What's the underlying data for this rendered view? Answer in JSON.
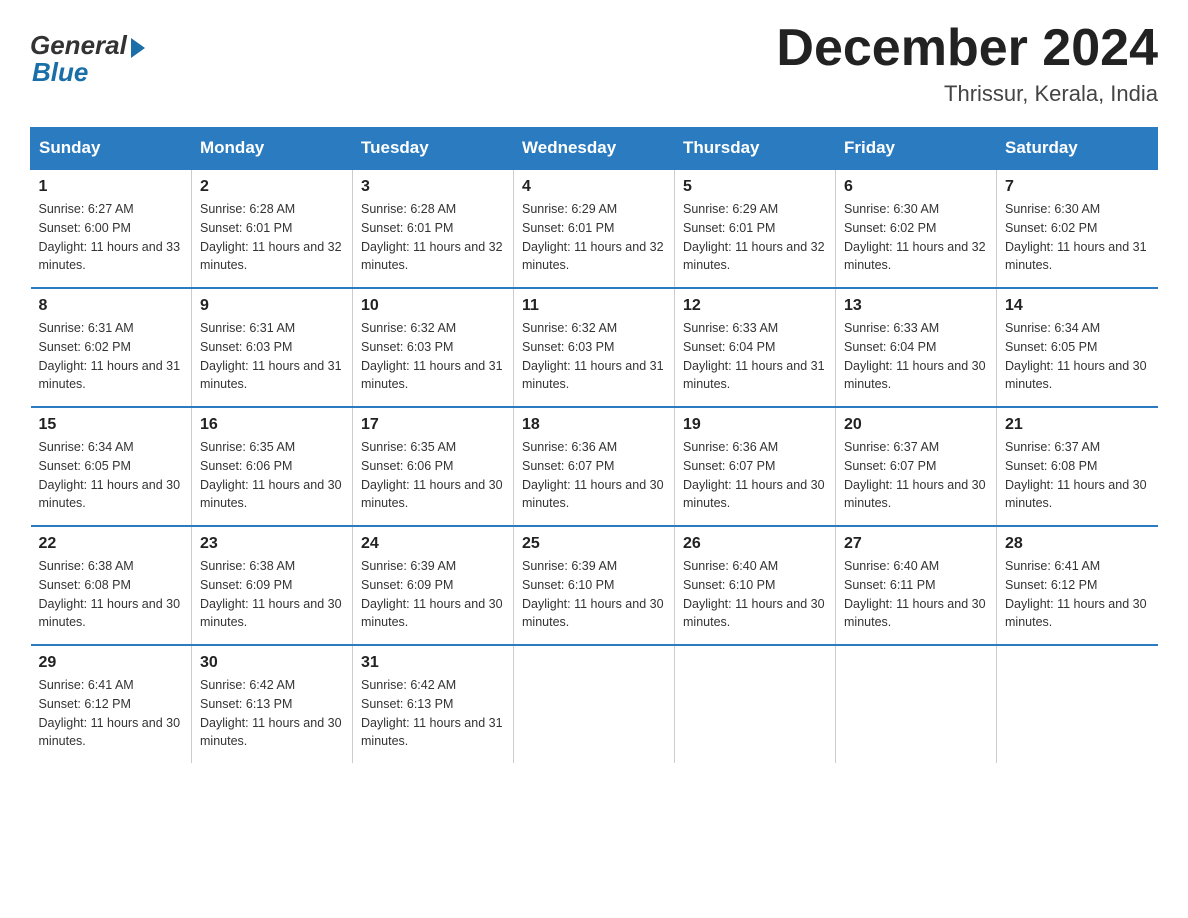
{
  "logo": {
    "general": "General",
    "blue": "Blue"
  },
  "title": "December 2024",
  "subtitle": "Thrissur, Kerala, India",
  "days_of_week": [
    "Sunday",
    "Monday",
    "Tuesday",
    "Wednesday",
    "Thursday",
    "Friday",
    "Saturday"
  ],
  "weeks": [
    [
      {
        "num": "1",
        "sunrise": "6:27 AM",
        "sunset": "6:00 PM",
        "daylight": "11 hours and 33 minutes."
      },
      {
        "num": "2",
        "sunrise": "6:28 AM",
        "sunset": "6:01 PM",
        "daylight": "11 hours and 32 minutes."
      },
      {
        "num": "3",
        "sunrise": "6:28 AM",
        "sunset": "6:01 PM",
        "daylight": "11 hours and 32 minutes."
      },
      {
        "num": "4",
        "sunrise": "6:29 AM",
        "sunset": "6:01 PM",
        "daylight": "11 hours and 32 minutes."
      },
      {
        "num": "5",
        "sunrise": "6:29 AM",
        "sunset": "6:01 PM",
        "daylight": "11 hours and 32 minutes."
      },
      {
        "num": "6",
        "sunrise": "6:30 AM",
        "sunset": "6:02 PM",
        "daylight": "11 hours and 32 minutes."
      },
      {
        "num": "7",
        "sunrise": "6:30 AM",
        "sunset": "6:02 PM",
        "daylight": "11 hours and 31 minutes."
      }
    ],
    [
      {
        "num": "8",
        "sunrise": "6:31 AM",
        "sunset": "6:02 PM",
        "daylight": "11 hours and 31 minutes."
      },
      {
        "num": "9",
        "sunrise": "6:31 AM",
        "sunset": "6:03 PM",
        "daylight": "11 hours and 31 minutes."
      },
      {
        "num": "10",
        "sunrise": "6:32 AM",
        "sunset": "6:03 PM",
        "daylight": "11 hours and 31 minutes."
      },
      {
        "num": "11",
        "sunrise": "6:32 AM",
        "sunset": "6:03 PM",
        "daylight": "11 hours and 31 minutes."
      },
      {
        "num": "12",
        "sunrise": "6:33 AM",
        "sunset": "6:04 PM",
        "daylight": "11 hours and 31 minutes."
      },
      {
        "num": "13",
        "sunrise": "6:33 AM",
        "sunset": "6:04 PM",
        "daylight": "11 hours and 30 minutes."
      },
      {
        "num": "14",
        "sunrise": "6:34 AM",
        "sunset": "6:05 PM",
        "daylight": "11 hours and 30 minutes."
      }
    ],
    [
      {
        "num": "15",
        "sunrise": "6:34 AM",
        "sunset": "6:05 PM",
        "daylight": "11 hours and 30 minutes."
      },
      {
        "num": "16",
        "sunrise": "6:35 AM",
        "sunset": "6:06 PM",
        "daylight": "11 hours and 30 minutes."
      },
      {
        "num": "17",
        "sunrise": "6:35 AM",
        "sunset": "6:06 PM",
        "daylight": "11 hours and 30 minutes."
      },
      {
        "num": "18",
        "sunrise": "6:36 AM",
        "sunset": "6:07 PM",
        "daylight": "11 hours and 30 minutes."
      },
      {
        "num": "19",
        "sunrise": "6:36 AM",
        "sunset": "6:07 PM",
        "daylight": "11 hours and 30 minutes."
      },
      {
        "num": "20",
        "sunrise": "6:37 AM",
        "sunset": "6:07 PM",
        "daylight": "11 hours and 30 minutes."
      },
      {
        "num": "21",
        "sunrise": "6:37 AM",
        "sunset": "6:08 PM",
        "daylight": "11 hours and 30 minutes."
      }
    ],
    [
      {
        "num": "22",
        "sunrise": "6:38 AM",
        "sunset": "6:08 PM",
        "daylight": "11 hours and 30 minutes."
      },
      {
        "num": "23",
        "sunrise": "6:38 AM",
        "sunset": "6:09 PM",
        "daylight": "11 hours and 30 minutes."
      },
      {
        "num": "24",
        "sunrise": "6:39 AM",
        "sunset": "6:09 PM",
        "daylight": "11 hours and 30 minutes."
      },
      {
        "num": "25",
        "sunrise": "6:39 AM",
        "sunset": "6:10 PM",
        "daylight": "11 hours and 30 minutes."
      },
      {
        "num": "26",
        "sunrise": "6:40 AM",
        "sunset": "6:10 PM",
        "daylight": "11 hours and 30 minutes."
      },
      {
        "num": "27",
        "sunrise": "6:40 AM",
        "sunset": "6:11 PM",
        "daylight": "11 hours and 30 minutes."
      },
      {
        "num": "28",
        "sunrise": "6:41 AM",
        "sunset": "6:12 PM",
        "daylight": "11 hours and 30 minutes."
      }
    ],
    [
      {
        "num": "29",
        "sunrise": "6:41 AM",
        "sunset": "6:12 PM",
        "daylight": "11 hours and 30 minutes."
      },
      {
        "num": "30",
        "sunrise": "6:42 AM",
        "sunset": "6:13 PM",
        "daylight": "11 hours and 30 minutes."
      },
      {
        "num": "31",
        "sunrise": "6:42 AM",
        "sunset": "6:13 PM",
        "daylight": "11 hours and 31 minutes."
      },
      null,
      null,
      null,
      null
    ]
  ]
}
